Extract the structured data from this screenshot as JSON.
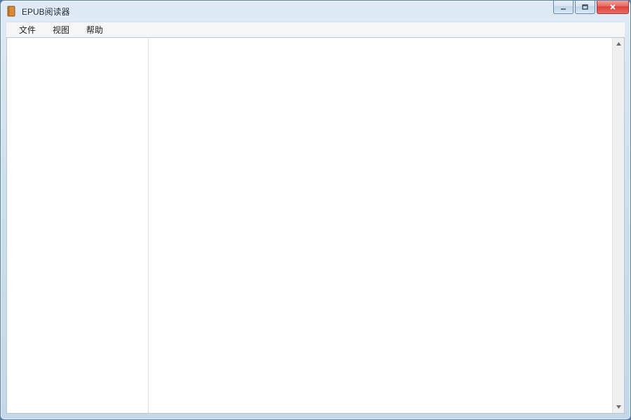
{
  "window": {
    "title": "EPUB阅读器"
  },
  "menu": {
    "items": [
      {
        "label": "文件"
      },
      {
        "label": "视图"
      },
      {
        "label": "帮助"
      }
    ]
  }
}
